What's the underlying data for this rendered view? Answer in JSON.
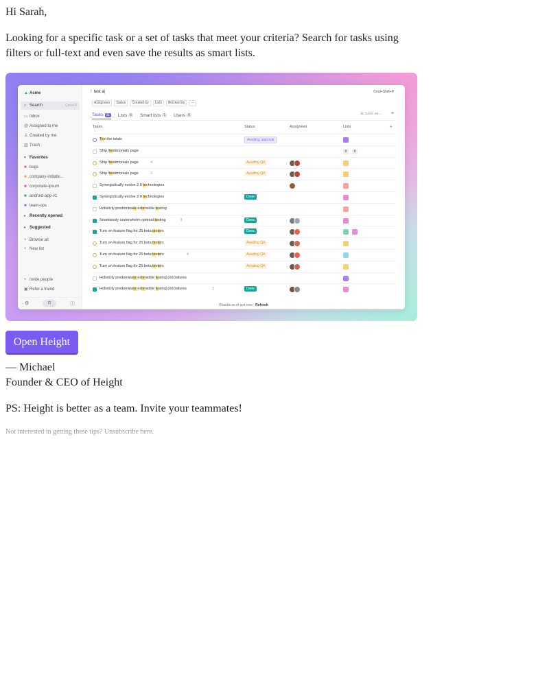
{
  "email": {
    "greeting": "Hi Sarah,",
    "intro": "Looking for a specific task or a set of tasks that meet your criteria? Search for tasks using filters or full-text and even save the results as smart lists.",
    "cta_label": "Open Height",
    "sign_name": "— Michael",
    "sign_title": "Founder & CEO of Height",
    "ps": "PS: Height is better as a team. Invite your teammates!",
    "unsubscribe": "Not interested in getting these tips? Unsubscribe here."
  },
  "colors": {
    "accent": "#7b5cf0",
    "done": "#17a29a",
    "awaiting_qa": "#d9962a",
    "awaiting_approval": "#7c6ef0"
  },
  "app": {
    "workspace": "Acme",
    "sidebar": {
      "search_label": "Search",
      "search_shortcut": "Cmd+P",
      "nav": [
        {
          "label": "Inbox",
          "icon": "inbox-icon"
        },
        {
          "label": "Assigned to me",
          "icon": "at-icon"
        },
        {
          "label": "Created by me",
          "icon": "user-icon"
        },
        {
          "label": "Trash",
          "icon": "trash-icon"
        }
      ],
      "favorites_label": "Favorites",
      "favorites": [
        {
          "label": "bugs",
          "color": "#e8634f"
        },
        {
          "label": "company-initiativ...",
          "color": "#e6a53a"
        },
        {
          "label": "corporate-ipsum",
          "color": "#d64fbf"
        },
        {
          "label": "android-app-v1",
          "color": "#17a29a"
        },
        {
          "label": "team-ops",
          "color": "#7c6ef0"
        }
      ],
      "recently_opened_label": "Recently opened",
      "suggested_label": "Suggested",
      "browse_all_label": "Browse all",
      "new_list_label": "New list",
      "invite_label": "Invite people",
      "refer_label": "Refer a friend"
    },
    "search_query": "test a",
    "shortcut_hint": "Cmd+Shift+P",
    "filters": [
      "Assignees",
      "Status",
      "Created by",
      "Lists",
      "Blocked by",
      "···"
    ],
    "tabs": [
      {
        "label": "Tasks",
        "count": "11"
      },
      {
        "label": "Lists",
        "count": "6"
      },
      {
        "label": "Smart lists",
        "count": "1"
      },
      {
        "label": "Users",
        "count": "0"
      }
    ],
    "save_as_label": "Save as...",
    "columns": [
      "Tasks",
      "Status",
      "Assignees",
      "Lists"
    ],
    "tasks": [
      {
        "name": "Tee the totals",
        "status": "Awaiting approval",
        "kind": "appr",
        "avatars": [],
        "lists": [
          "#a57ff0"
        ],
        "sub": ""
      },
      {
        "name": "Ship /testimonials page",
        "status": "",
        "kind": "none",
        "avatars": [],
        "lists": [
          "#ddd",
          "#ddd"
        ],
        "sub": ""
      },
      {
        "name": "Ship /testimonials page",
        "status": "Awaiting QA",
        "kind": "qa",
        "avatars": [
          "#6b5a4a",
          "#b04a3a"
        ],
        "lists": [
          "#f3d07a"
        ],
        "sub": "4"
      },
      {
        "name": "Ship /testimonials page",
        "status": "Awaiting QA",
        "kind": "qa",
        "avatars": [
          "#6b5a4a",
          "#b04a3a"
        ],
        "lists": [
          "#f3d07a"
        ],
        "sub": "2"
      },
      {
        "name": "Synergistically evolve 2.0 technologies",
        "status": "",
        "kind": "none",
        "avatars": [
          "#9a5a3a"
        ],
        "lists": [
          "#f4a3a0"
        ],
        "sub": ""
      },
      {
        "name": "Synergistically evolve 2.0 technologies",
        "status": "Done",
        "kind": "done",
        "avatars": [],
        "lists": [
          "#e58ad6"
        ],
        "sub": ""
      },
      {
        "name": "Holisticly predominate extensible testing",
        "status": "",
        "kind": "none",
        "avatars": [],
        "lists": [
          "#f4a3a0"
        ],
        "sub": ""
      },
      {
        "name": "Seamlessly underwhelm optimal testing",
        "status": "Done",
        "kind": "done",
        "avatars": [
          "#7a7a7a",
          "#9ab"
        ],
        "lists": [
          "#e58ad6"
        ],
        "sub": "3"
      },
      {
        "name": "Turn on feature flag for 25 beta testers",
        "status": "Done",
        "kind": "done",
        "avatars": [
          "#6b5a4a",
          "#e8634f"
        ],
        "lists": [
          "#7fd4b8",
          "#e58ad6"
        ],
        "sub": ""
      },
      {
        "name": "Turn on feature flag for 25 beta testers",
        "status": "Awaiting QA",
        "kind": "qa",
        "avatars": [
          "#6b5a4a",
          "#c96a5a"
        ],
        "lists": [
          "#f3d07a"
        ],
        "sub": ""
      },
      {
        "name": "Turn on feature flag for 25 beta testers",
        "status": "Awaiting QA",
        "kind": "qa",
        "avatars": [
          "#6b5a4a",
          "#e8634f"
        ],
        "lists": [
          "#8fd4e8"
        ],
        "sub": "4"
      },
      {
        "name": "Turn on feature flag for 25 beta testers",
        "status": "Awaiting QA",
        "kind": "qa",
        "avatars": [
          "#6b5a4a",
          "#c96a5a"
        ],
        "lists": [
          "#f3d07a"
        ],
        "sub": ""
      },
      {
        "name": "Holisticly predominate extensible testing procedures",
        "status": "",
        "kind": "none",
        "avatars": [],
        "lists": [
          "#a57ff0"
        ],
        "sub": ""
      },
      {
        "name": "Holisticly predominate extensible testing procedures",
        "status": "Done",
        "kind": "done",
        "avatars": [
          "#7a4a3a",
          "#888"
        ],
        "lists": [
          "#e58ad6"
        ],
        "sub": "2"
      }
    ],
    "results_text": "Results as of just now",
    "refresh_label": "Refresh"
  }
}
